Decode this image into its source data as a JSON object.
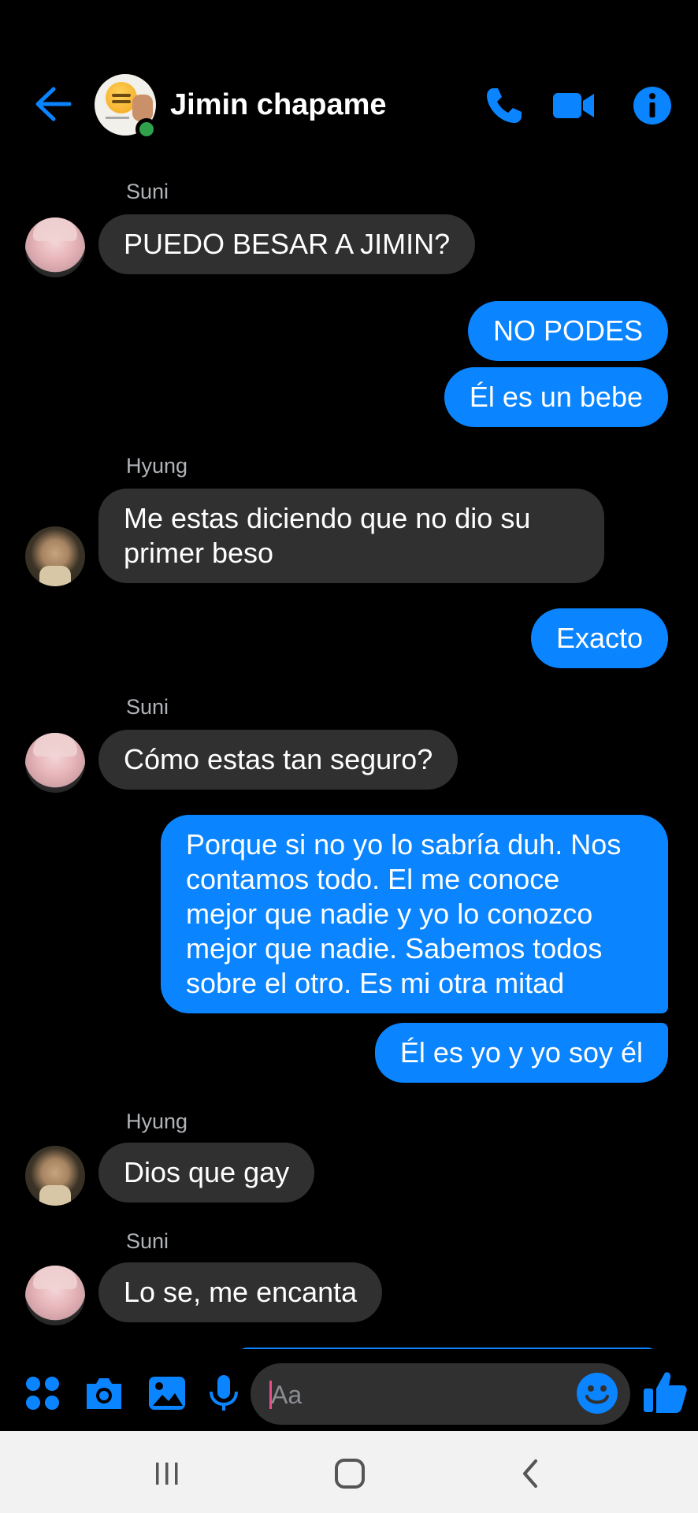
{
  "header": {
    "title": "Jimin chapame",
    "online": true
  },
  "messages": [
    {
      "sender": "Suni",
      "direction": "in",
      "text": "PUEDO BESAR A JIMIN?"
    },
    {
      "direction": "out",
      "text": "NO PODES"
    },
    {
      "direction": "out",
      "text": "Él es un bebe"
    },
    {
      "sender": "Hyung",
      "direction": "in",
      "lines": [
        "Me estas diciendo que no dio su",
        "primer beso"
      ]
    },
    {
      "direction": "out",
      "text": "Exacto"
    },
    {
      "sender": "Suni",
      "direction": "in",
      "text": "Cómo estas tan seguro?"
    },
    {
      "direction": "out",
      "lines": [
        "Porque si no yo lo sabría duh. Nos",
        "contamos todo. El me conoce",
        "mejor que nadie y yo lo conozco",
        "mejor que nadie. Sabemos todos",
        "sobre el otro. Es mi otra mitad"
      ]
    },
    {
      "direction": "out",
      "text": "Él es yo y yo soy él"
    },
    {
      "sender": "Hyung",
      "direction": "in",
      "text": "Dios que gay"
    },
    {
      "sender": "Suni",
      "direction": "in",
      "text": "Lo se, me encanta"
    }
  ],
  "composer": {
    "placeholder": "Aa"
  },
  "icons": {
    "back": "back-arrow-icon",
    "call": "phone-icon",
    "video": "video-camera-icon",
    "info": "info-icon",
    "menu": "apps-grid-icon",
    "camera": "camera-icon",
    "gallery": "image-icon",
    "mic": "microphone-icon",
    "emoji": "smiley-icon",
    "like": "thumbs-up-icon"
  },
  "colors": {
    "accent": "#0a84ff",
    "incoming_bubble": "#303030",
    "background": "#000000",
    "online": "#31a24c"
  }
}
